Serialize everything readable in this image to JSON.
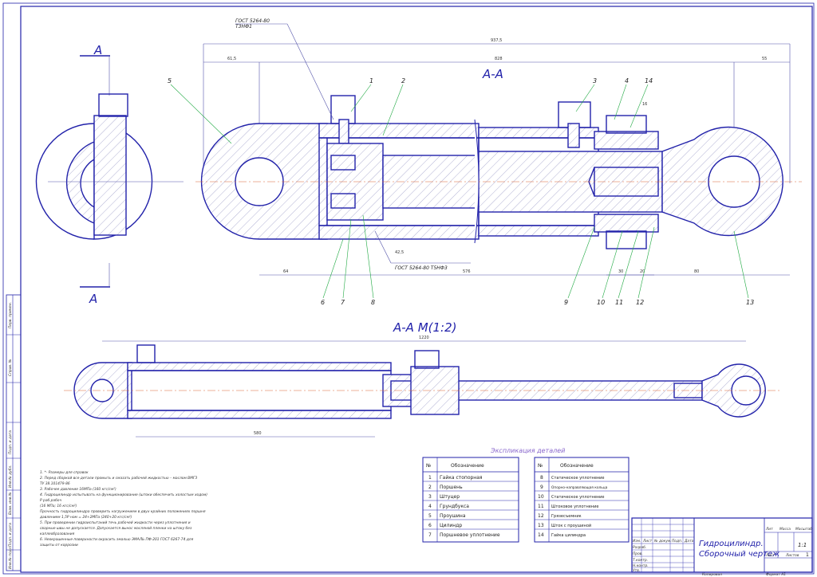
{
  "section_labels": {
    "view_a_top": "A",
    "view_a_bottom": "A",
    "main": "A-A",
    "secondary": "A-A M(1:2)"
  },
  "gost_labels": {
    "top": "ГОСТ 5264-80",
    "top_sub": "Т3НФ1",
    "bottom": "ГОСТ 5264-80 Т5НФ3"
  },
  "dimensions": {
    "overall": "937,5",
    "left": "61,5",
    "main_len": "828",
    "right": "55",
    "d1": "576",
    "d2": "64",
    "d3": "42,5",
    "d4": "30",
    "d5": "20",
    "d6": "80",
    "d7": "1220",
    "d8": "580",
    "d9": "16"
  },
  "callouts": [
    "5",
    "1",
    "2",
    "3",
    "4",
    "14",
    "6",
    "7",
    "8",
    "9",
    "10",
    "11",
    "12",
    "13"
  ],
  "explication": {
    "title": "Экспликация деталей",
    "header_num": "№",
    "header_name": "Обозначение",
    "left": [
      {
        "n": "1",
        "name": "Гайка стопорная"
      },
      {
        "n": "2",
        "name": "Поршень"
      },
      {
        "n": "3",
        "name": "Штуцер"
      },
      {
        "n": "4",
        "name": "Грундбукса"
      },
      {
        "n": "5",
        "name": "Проушина"
      },
      {
        "n": "6",
        "name": "Цилиндр"
      },
      {
        "n": "7",
        "name": "Поршневое уплотнение"
      }
    ],
    "right": [
      {
        "n": "8",
        "name": "Статическое уплотнение"
      },
      {
        "n": "9",
        "name": "Опорно-направляющая кольца"
      },
      {
        "n": "10",
        "name": "Статическое уплотнение"
      },
      {
        "n": "11",
        "name": "Штоковое уплотнение"
      },
      {
        "n": "12",
        "name": "Грязесъемник"
      },
      {
        "n": "13",
        "name": "Шток с проушиной"
      },
      {
        "n": "14",
        "name": "Гайка цилиндра"
      }
    ]
  },
  "notes": [
    "1. *- Размеры для справок",
    "2. Перед сборкой все детали промыть и смазать рабочей жидкостью – маслом ВМГЗ",
    "ТУ 38.101479-86",
    "3. Рабочее давление 16МПа (160 кгс/см²)",
    "4. Гидроцилиндр испытывать на функционирование (штоки обеспечить холостым ходом)",
    "Р раб.рабоч",
    "(16 МПа; 16 кгс/см²)",
    "Прочность гидроцилиндра проверить нагружением в двух крайних положениях поршня",
    "давлением 1,5Р ном = 24+2МПа (240+20 кгс/см²)",
    "5. При проведении гидроиспытаний течь рабочей жидкости через уплотнения и",
    "сварные швы не допускается. Допускается вынос масляной пленки на штоку без",
    "каплеобразования",
    "6. Неокрашенные поверхности окрасить эмалью ЭМАЛЬ ПФ-201 ГОСТ 6267-74 для",
    "защиты от коррозии"
  ],
  "title_block": {
    "name_line1": "Гидроцилиндр.",
    "name_line2": "Сборочный чертеж",
    "lit": "Лит",
    "mass": "Масса",
    "scale": "Масштаб",
    "scale_val": "1:1",
    "sheet": "Лист",
    "sheets": "Листов",
    "sheets_val": "1",
    "rows": [
      "Изм.",
      "Лист",
      "№ докум.",
      "Подп.",
      "Дата"
    ],
    "roles": [
      "Разраб.",
      "Пров.",
      "Т.контр.",
      "",
      "Н.контр.",
      "Утв."
    ],
    "copied": "Копировал",
    "format": "Формат  А1"
  },
  "side_stamp": [
    "Инв.№ подл.",
    "Подп. и дата",
    "Взам. инв.№",
    "Инв.№ дубл.",
    "Подп. и дата",
    "Справ. №",
    "Перв. примен."
  ]
}
